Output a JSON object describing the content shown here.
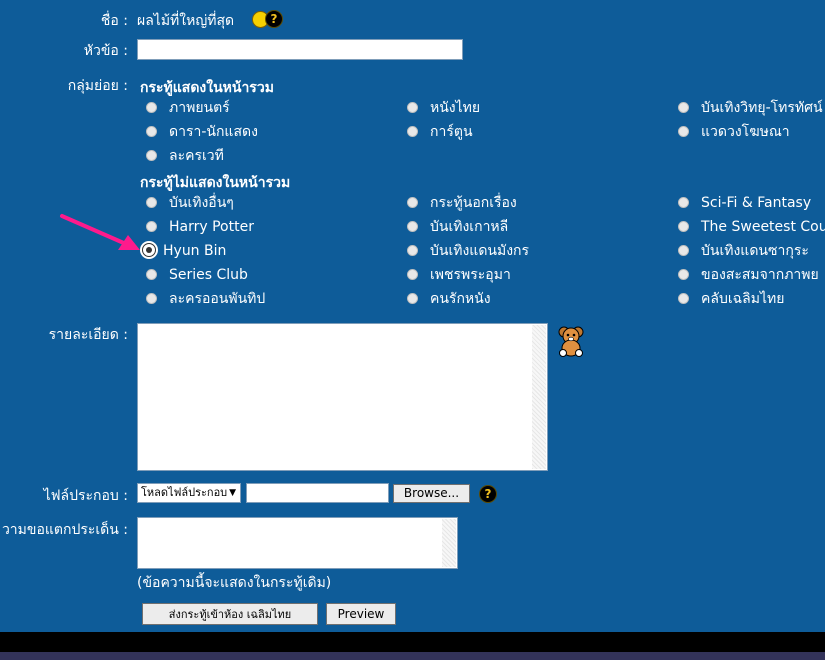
{
  "form": {
    "name_label": "ชื่อ :",
    "name_value": "ผลไม้ที่ใหญ่ที่สุด",
    "topic_label": "หัวข้อ :",
    "topic_value": "",
    "subgroup_label": "กลุ่มย่อย :",
    "group_shown_title": "กระทู้แสดงในหน้ารวม",
    "group_hidden_title": "กระทู้ไม่แสดงในหน้ารวม",
    "shown_options": [
      [
        "ภาพยนตร์",
        "หนังไทย",
        "บันเทิงวิทยุ-โทรทัศน์"
      ],
      [
        "ดารา-นักแสดง",
        "การ์ตูน",
        "แวดวงโฆษณา"
      ],
      [
        "ละครเวที",
        "",
        ""
      ]
    ],
    "hidden_options": [
      [
        "บันเทิงอื่นๆ",
        "กระทู้นอกเรื่อง",
        "Sci-Fi & Fantasy"
      ],
      [
        "Harry Potter",
        "บันเทิงเกาหลี",
        "The Sweetest Cou"
      ],
      [
        "Hyun Bin",
        "บันเทิงแดนมังกร",
        "บันเทิงแดนซากุระ"
      ],
      [
        "Series Club",
        "เพชรพระอุมา",
        "ของสะสมจากภาพย"
      ],
      [
        "ละครออนพันทิป",
        "คนรักหนัง",
        "คลับเฉลิมไทย"
      ]
    ],
    "selected_option": "Hyun Bin",
    "detail_label": "รายละเอียด :",
    "detail_value": "",
    "attach_label": "ไฟล์ประกอบ :",
    "attach_type_selected": "โหลดไฟล์ประกอบ",
    "attach_path": "",
    "browse_label": "Browse...",
    "comment_label": "วามขอแตกประเด็น :",
    "comment_value": "",
    "comment_note": "(ข้อความนี้จะแสดงในกระทู้เดิม)",
    "submit_label": "ส่งกระทู้เข้าห้อง เฉลิมไทย",
    "preview_label": "Preview"
  },
  "icons": {
    "help": "help-icon",
    "emoticon": "smiley-icon",
    "teddy": "teddy-bear-icon",
    "arrow": "pink-arrow-annotation"
  },
  "colors": {
    "background": "#0e5c99",
    "arrow": "#ff1a8c"
  }
}
